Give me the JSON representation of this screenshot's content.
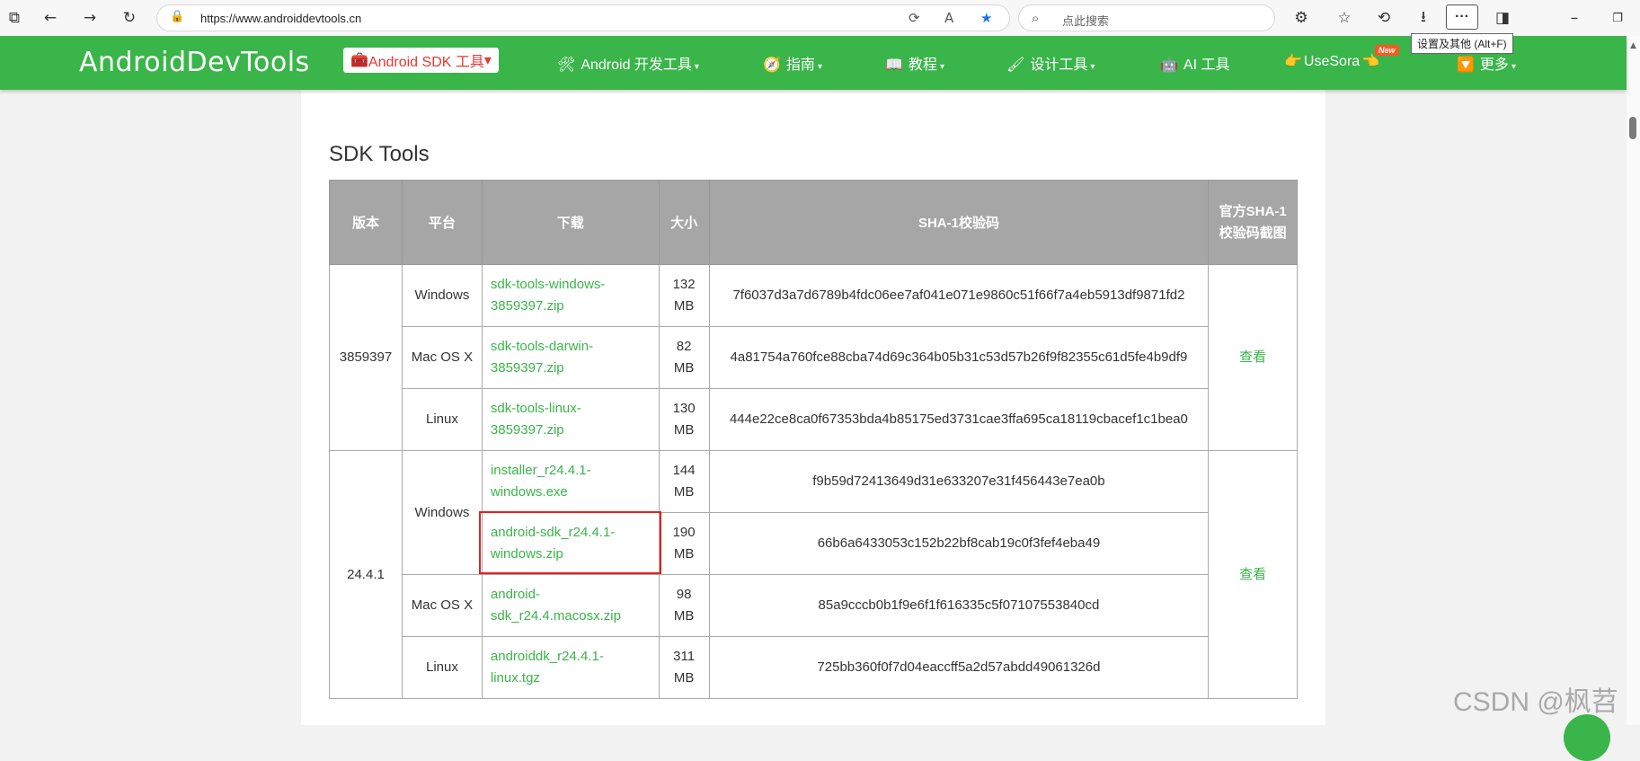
{
  "browser": {
    "url": "https://www.androiddevtools.cn",
    "search_placeholder": "点此搜索",
    "more_label": "···",
    "tooltip": "设置及其他 (Alt+F)"
  },
  "site": {
    "logo": "AndroidDevTools",
    "nav": [
      {
        "label": "Android SDK 工具"
      },
      {
        "label": "Android 开发工具"
      },
      {
        "label": "指南"
      },
      {
        "label": "教程"
      },
      {
        "label": "设计工具"
      },
      {
        "label": "AI 工具"
      },
      {
        "label": "UseSora"
      },
      {
        "label": "更多"
      }
    ],
    "new_badge": "New"
  },
  "section_title": "SDK Tools",
  "table": {
    "headers": [
      "版本",
      "平台",
      "下载",
      "大小",
      "SHA-1校验码",
      "官方SHA-1校验码截图"
    ],
    "groups": [
      {
        "version": "3859397",
        "view": "查看",
        "rows": [
          {
            "platform": "Windows",
            "file": "sdk-tools-windows-3859397.zip",
            "size": "132 MB",
            "sha1": "7f6037d3a7d6789b4fdc06ee7af041e071e9860c51f66f7a4eb5913df9871fd2"
          },
          {
            "platform": "Mac OS X",
            "file": "sdk-tools-darwin-3859397.zip",
            "size": "82 MB",
            "sha1": "4a81754a760fce88cba74d69c364b05b31c53d57b26f9f82355c61d5fe4b9df9"
          },
          {
            "platform": "Linux",
            "file": "sdk-tools-linux-3859397.zip",
            "size": "130 MB",
            "sha1": "444e22ce8ca0f67353bda4b85175ed3731cae3ffa695ca18119cbacef1c1bea0"
          }
        ]
      },
      {
        "version": "24.4.1",
        "view": "查看",
        "platform_windows": "Windows",
        "rows": [
          {
            "file": "installer_r24.4.1-windows.exe",
            "size": "144 MB",
            "sha1": "f9b59d72413649d31e633207e31f456443e7ea0b"
          },
          {
            "file": "android-sdk_r24.4.1-windows.zip",
            "size": "190 MB",
            "sha1": "66b6a6433053c152b22bf8cab19c0f3fef4eba49"
          },
          {
            "platform": "Mac OS X",
            "file": "android-sdk_r24.4.macosx.zip",
            "size": "98 MB",
            "sha1": "85a9cccb0b1f9e6f1f616335c5f07107553840cd"
          },
          {
            "platform": "Linux",
            "file": "androiddk_r24.4.1-linux.tgz",
            "size": "311 MB",
            "sha1": "725bb360f0f7d04eaccff5a2d57abdd49061326d"
          }
        ]
      }
    ]
  },
  "watermark": "CSDN @枫苕",
  "colors": {
    "brand_green": "#3ab54a",
    "header_gray": "#a6a6a6",
    "link_green": "#3ab54a",
    "highlight_red": "#e02020"
  }
}
